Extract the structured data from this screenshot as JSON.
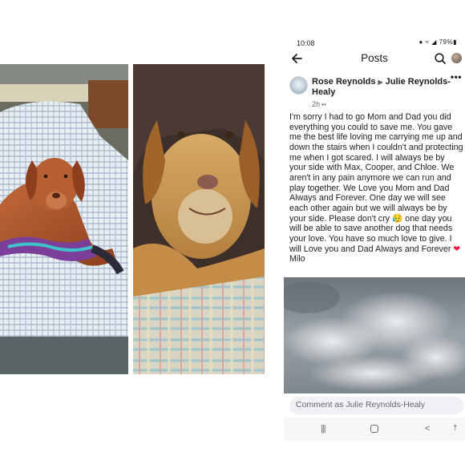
{
  "photos": {
    "left_alt": "red dog on bed",
    "right_alt": "older golden dog close-up"
  },
  "status_bar": {
    "time": "10:08",
    "icons_text": "● ≈ ◢ 79%▮"
  },
  "topbar": {
    "title": "Posts",
    "back_icon": "arrow-left-icon",
    "search_icon": "search-icon"
  },
  "post": {
    "author": "Rose Reynolds",
    "arrow": "▶",
    "recipient": "Julie Reynolds-Healy",
    "time": "2h",
    "audience_icon": "••",
    "more": "•••",
    "text": "I'm sorry I had to go Mom and Dad you did everything you could to save me. You gave me the best life loving me  carrying me up and down the stairs when I couldn't and protecting me when I got scared. I will always be by your side with Max, Cooper, and Chloe. We aren't in any pain anymore we can run and play together. We Love you Mom and Dad Always and Forever. One day we will see each other again but we will always be by your side. Please don't cry ",
    "emoji": "😥",
    "text_after_emoji": " one day you will be able to save another dog that needs your love. You have so much love to give.  I will Love you and Dad Always and Forever ",
    "heart": "❤",
    "signoff": " Milo"
  },
  "comment": {
    "placeholder": "Comment as Julie Reynolds-Healy"
  },
  "navbar": {
    "recents": "|||",
    "back": "<",
    "accessibility": "†"
  },
  "colors": {
    "text": "#1c1e21",
    "secondary": "#65676b",
    "comment_bg": "#f0f2f5",
    "heart": "#e41e3f"
  }
}
